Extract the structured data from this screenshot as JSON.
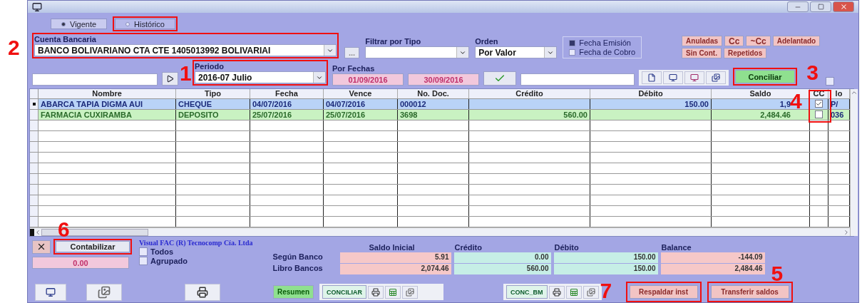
{
  "tabs": [
    {
      "label": "Vigente",
      "selected": true
    },
    {
      "label": "Histórico",
      "selected": false,
      "highlighted": true
    }
  ],
  "corner_checkbox": {
    "checked": false
  },
  "account": {
    "label": "Cuenta Bancaria",
    "value": "BANCO BOLIVARIANO CTA CTE 1405013992 BOLIVARIAI",
    "annotation": "2"
  },
  "browse_button": "...",
  "type_filter": {
    "label": "Filtrar por Tipo"
  },
  "order": {
    "label": "Orden",
    "value": "Por Valor"
  },
  "date_mode": [
    {
      "label": "Fecha Emisión",
      "selected": true
    },
    {
      "label": "Fecha de Cobro",
      "selected": false
    }
  ],
  "filter_buttons": [
    [
      {
        "label": "Anuladas"
      },
      {
        "label": "Cc"
      },
      {
        "label": "~Cc"
      },
      {
        "label": "Adelantado"
      }
    ],
    [
      {
        "label": "Sin Cont."
      },
      {
        "label": "Repetidos"
      }
    ]
  ],
  "period": {
    "label": "Periodo",
    "value": "2016-07  Julio",
    "annotation": "1"
  },
  "date_range": {
    "label": "Por Fechas",
    "from": "01/09/2016",
    "to": "30/09/2016"
  },
  "conciliate_button": {
    "label": "Conciliar",
    "annotation": "3"
  },
  "table": {
    "columns": [
      "Nombre",
      "Tipo",
      "Fecha",
      "Vence",
      "No. Doc.",
      "Crédito",
      "Débito",
      "Saldo",
      "CC",
      "lo"
    ],
    "cc_annotation": "4",
    "rows": [
      {
        "current": true,
        "color": "#b9d3f7",
        "cells": [
          "ABARCA TAPIA DIGMA AUI",
          "CHEQUE",
          "04/07/2016",
          "04/07/2016",
          "000012",
          "",
          "150.00",
          "1,9"
        ],
        "cc": true,
        "extra": "P/"
      },
      {
        "current": false,
        "color": "#c9f2c2",
        "cells": [
          "FARMACIA CUXIRAMBA",
          "DEPOSITO",
          "25/07/2016",
          "25/07/2016",
          "3698",
          "560.00",
          "",
          "2,484.46"
        ],
        "cc": false,
        "extra": "036"
      }
    ]
  },
  "footer": {
    "contabilizar": {
      "label": "Contabilizar",
      "annotation": "6"
    },
    "total": "0.00",
    "company": "Visual FAC (R) Tecnocomp Cía. Ltda",
    "options": [
      {
        "label": "Todos",
        "checked": false
      },
      {
        "label": "Agrupado",
        "checked": false
      }
    ]
  },
  "summary": {
    "columns": [
      "Saldo Inicial",
      "Crédito",
      "Débito",
      "Balance"
    ],
    "rows": [
      {
        "label": "Según Banco",
        "values": [
          "5.91",
          "0.00",
          "150.00",
          "-144.09"
        ]
      },
      {
        "label": "Libro Bancos",
        "values": [
          "2,074.46",
          "560.00",
          "150.00",
          "2,484.46"
        ]
      }
    ]
  },
  "actions": {
    "resumen": "Resumen",
    "conciliar": "CONCILIAR",
    "conc_bm": "CONC_BM",
    "backup": {
      "label": "Respaldar inst",
      "annotation": "7"
    },
    "transfer": {
      "label": "Transferir saldos",
      "annotation": "5"
    }
  }
}
